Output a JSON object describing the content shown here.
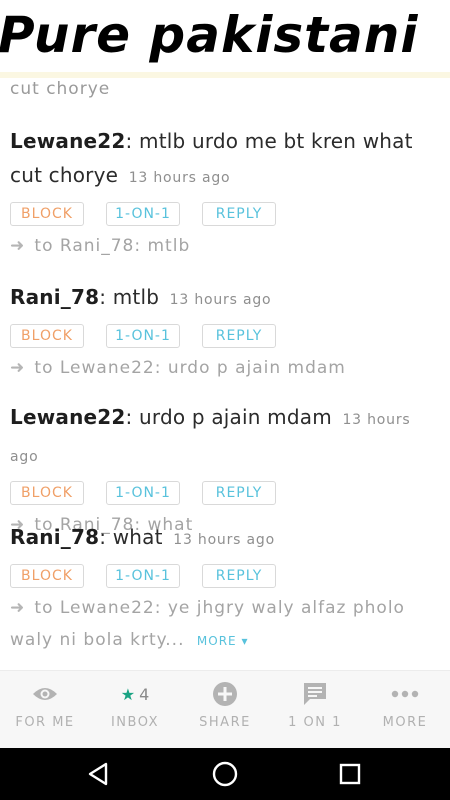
{
  "header": {
    "title": "Pure pakistani"
  },
  "feed": {
    "cut_top_text": "cut chorye",
    "comments": [
      {
        "user": "Lewane22",
        "text": ": mtlb urdo me bt kren what cut chorye",
        "time": "13 hours ago",
        "reply_to": "to Rani_78: mtlb"
      },
      {
        "user": "Rani_78",
        "text": ": mtlb",
        "time": "13 hours ago",
        "reply_to": "to Lewane22: urdo p ajain mdam"
      },
      {
        "user": "Lewane22",
        "text": ": urdo p ajain mdam",
        "time": "13 hours ago",
        "reply_to": "to Rani_78: what"
      },
      {
        "user": "Rani_78",
        "text": ": what",
        "time": "13 hours ago",
        "reply_to": "to Lewane22: ye jhgry waly alfaz pholo waly ni bola krty...",
        "more_label": "MORE ▾"
      }
    ],
    "actions": {
      "block": "BLOCK",
      "one_on_one": "1-ON-1",
      "reply": "REPLY"
    }
  },
  "bottom_nav": {
    "items": [
      {
        "label": "FOR ME",
        "icon": "eye-icon"
      },
      {
        "label": "INBOX",
        "icon": "star-icon",
        "badge": "4"
      },
      {
        "label": "SHARE",
        "icon": "plus-circle-icon"
      },
      {
        "label": "1 ON 1",
        "icon": "chat-bubble-icon"
      },
      {
        "label": "MORE",
        "icon": "dots-icon"
      }
    ]
  },
  "colors": {
    "block": "#f0a068",
    "action": "#58c2dc",
    "inbox_star": "#1aa383"
  }
}
